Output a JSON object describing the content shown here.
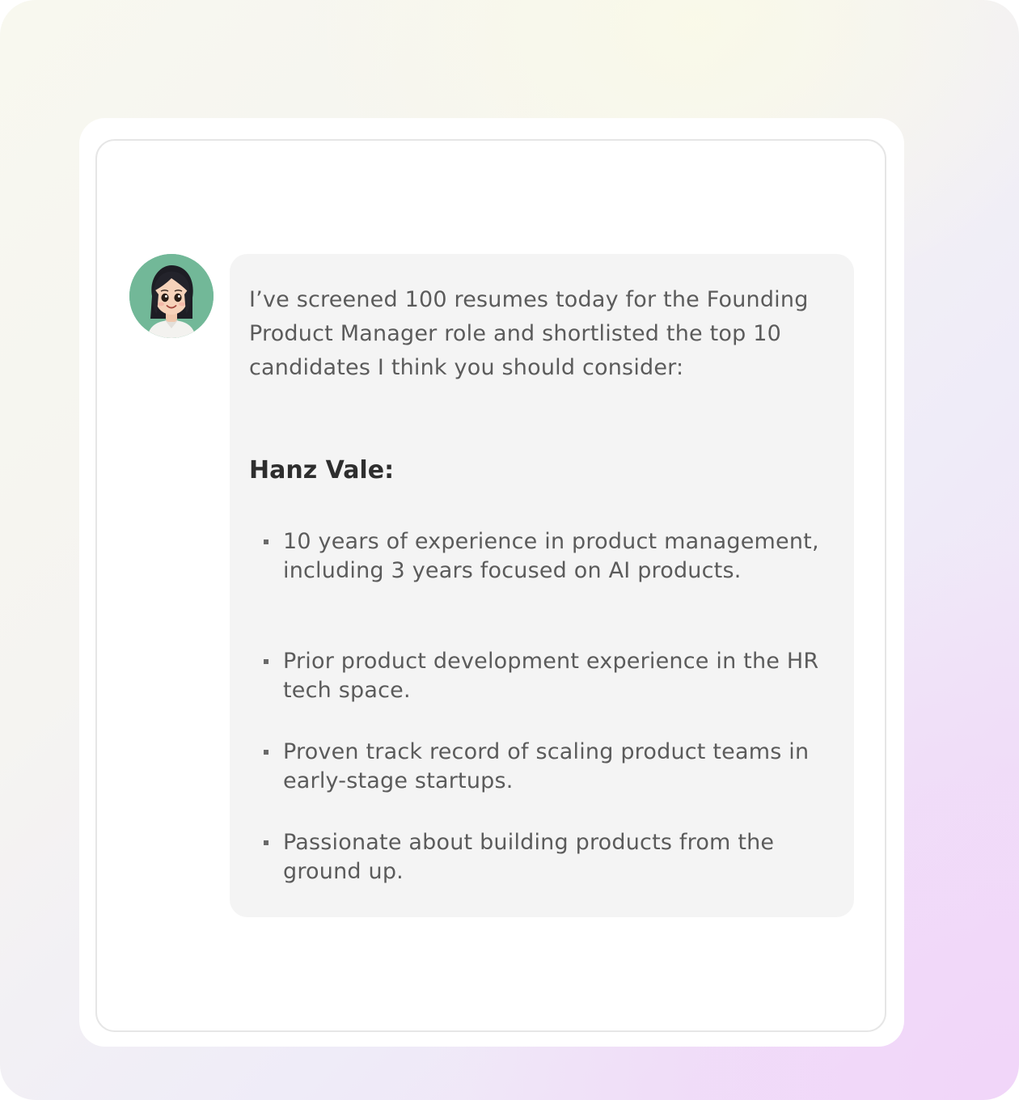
{
  "message": {
    "intro": " I’ve screened 100 resumes today for the Founding Product Manager role and shortlisted the top 10 candidates I think you should consider:",
    "candidate_name": "Hanz Vale:",
    "bullets": [
      {
        "text": "10 years of experience in product management, including 3 years focused on AI products."
      },
      {
        "text": "Prior product development experience in the HR tech space."
      },
      {
        "text": "Proven track record of scaling product teams in early-stage startups."
      },
      {
        "text": "Passionate about building products from the ground up."
      }
    ]
  },
  "avatar": {
    "icon": "assistant-avatar-icon",
    "background_color": "#72b898"
  },
  "colors": {
    "bubble_background": "#f4f4f4",
    "body_text": "#5b5b5b",
    "heading_text": "#2e2e2e"
  }
}
